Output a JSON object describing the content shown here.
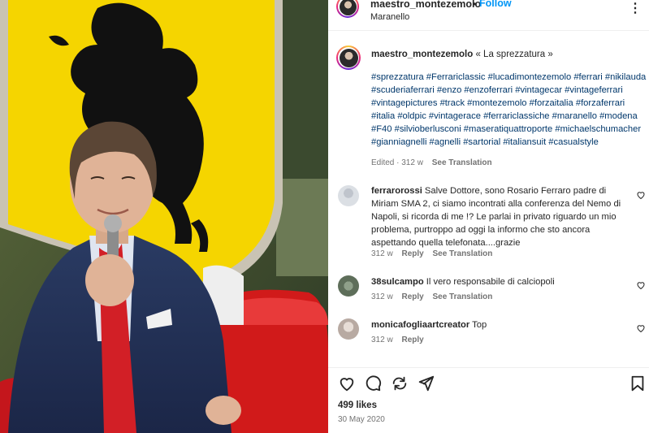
{
  "post": {
    "username": "maestro_montezemolo",
    "separator": "•",
    "follow_label": "Follow",
    "location": "Maranello",
    "more_label": "⋮"
  },
  "caption": {
    "username": "maestro_montezemolo",
    "text": "« La sprezzatura »",
    "hashtags": "#sprezzatura #Ferrariclassic #lucadimontezemolo #ferrari #nikilauda #scuderiaferrari #enzo #enzoferrari #vintagecar #vintageferrari #vintagepictures #track #montezemolo #forzaitalia #forzaferrari #italia #oldpic #vintagerace #ferrariclassiche #maranello #modena #F40 #silvioberlusconi #maseratiquattroporte #michaelschumacher #gianniagnelli #agnelli #sartorial #italiansuit #casualstyle",
    "meta_time": "Edited · 312 w",
    "see_translation": "See Translation"
  },
  "comments": [
    {
      "username": "ferrarorossi",
      "text": "Salve Dottore, sono Rosario Ferraro padre di Miriam SMA 2, ci siamo incontrati alla conferenza del Nemo di Napoli, si ricorda di me !? Le parlai in privato riguardo un mio problema, purtroppo ad oggi la informo che sto ancora aspettando quella telefonata....grazie",
      "time": "312 w",
      "reply": "Reply",
      "see_translation": "See Translation"
    },
    {
      "username": "38sulcampo",
      "text": "Il vero responsabile di calciopoli",
      "time": "312 w",
      "reply": "Reply",
      "see_translation": "See Translation"
    },
    {
      "username": "monicafogliaartcreator",
      "text": "Top",
      "time": "312 w",
      "reply": "Reply"
    }
  ],
  "actions": {
    "icons": [
      "heart-icon",
      "comment-icon",
      "share-icon",
      "send-icon",
      "bookmark-icon"
    ]
  },
  "likes": "499 likes",
  "date": "30 May 2020",
  "colors": {
    "link": "#00376b",
    "follow": "#0095f6",
    "muted": "#737373",
    "ferrari_yellow": "#f5d500",
    "ferrari_red": "#c8102e"
  }
}
